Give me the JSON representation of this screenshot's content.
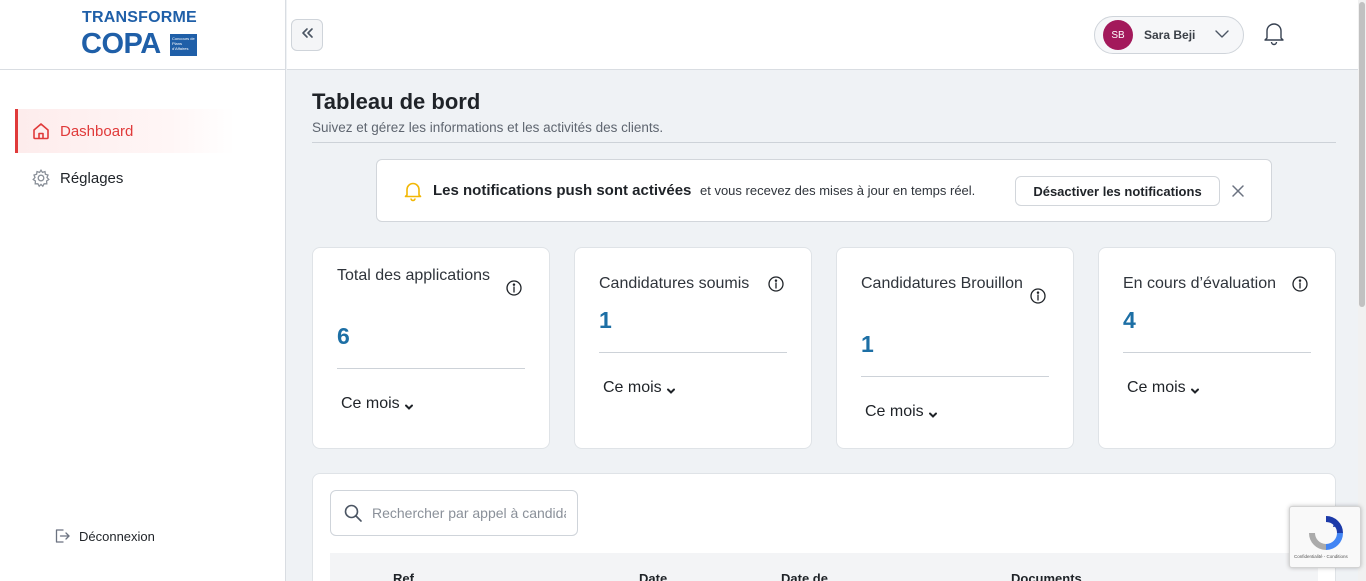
{
  "brand": {
    "logo_top": "TRANSFORME",
    "logo_main": "COPA",
    "logo_box": "Concours de Plans d'Affaires"
  },
  "sidebar": {
    "items": [
      {
        "label": "Dashboard",
        "icon": "home-icon",
        "active": true
      },
      {
        "label": "Réglages",
        "icon": "gear-icon",
        "active": false
      }
    ],
    "logout_label": "Déconnexion",
    "accent": "#e03a3a"
  },
  "topbar": {
    "user_initials": "SB",
    "user_name": "Sara Beji",
    "avatar_color": "#a3195b"
  },
  "page": {
    "title": "Tableau de bord",
    "subtitle": "Suivez et gérez les informations et les activités des clients."
  },
  "banner": {
    "strong": "Les notifications push sont activées",
    "text": "et vous recevez des mises à jour en temps réel.",
    "button": "Désactiver les notifications"
  },
  "cards": [
    {
      "label": "Total des applications",
      "value": "6",
      "period": "Ce mois"
    },
    {
      "label": "Candidatures soumis",
      "value": "1",
      "period": "Ce mois"
    },
    {
      "label": "Candidatures Brouillon",
      "value": "1",
      "period": "Ce mois"
    },
    {
      "label": "En cours d’évaluation",
      "value": "4",
      "period": "Ce mois"
    }
  ],
  "table": {
    "search_placeholder": "Rechercher par appel à candidature",
    "columns": [
      "Ref",
      "Date",
      "Date de",
      "Documents"
    ]
  },
  "recaptcha": {
    "text": "Confidentialité - Conditions"
  },
  "colors": {
    "value_blue": "#1d6fa5",
    "notice_yellow": "#f2b705"
  }
}
